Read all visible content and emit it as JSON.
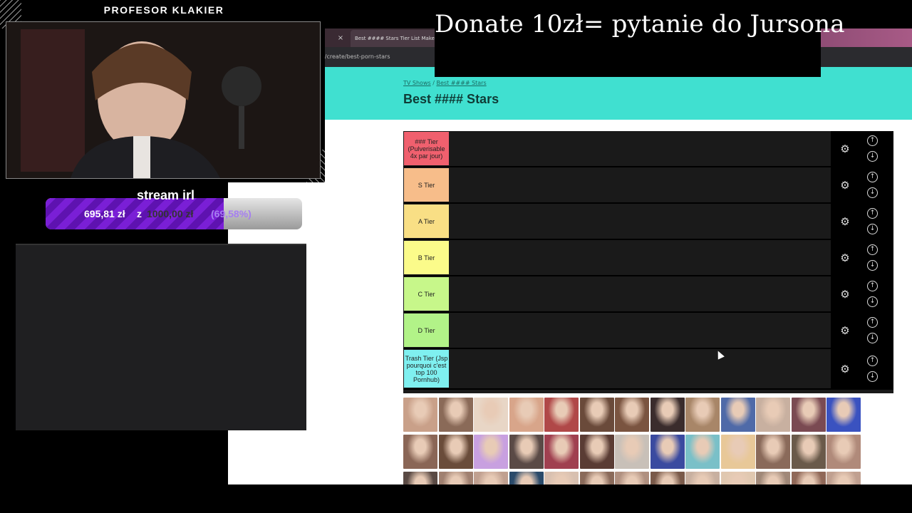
{
  "overlay": {
    "donate_text": "Donate 10zł= pytanie do Jursona",
    "streamer_name": "PROFESOR KLAKIER",
    "goal_title": "stream irl",
    "goal_amount": "695,81 zł",
    "goal_separator": "z",
    "goal_target": "1000,00 zł",
    "goal_percent": "(69,58%)",
    "goal_progress": 0.6958
  },
  "browser": {
    "tab_close": "×",
    "tab_title": "Best #### Stars Tier List Maker",
    "url": "m/create/best-porn-stars"
  },
  "page": {
    "breadcrumb_parent": "TV Shows",
    "breadcrumb_sep": "/",
    "breadcrumb_current": "Best #### Stars",
    "title": "Best #### Stars"
  },
  "tiers": [
    {
      "label": "### Tier (Pulverisable 4x par jour)",
      "color": "#f0606e"
    },
    {
      "label": "S Tier",
      "color": "#f7bd8a"
    },
    {
      "label": "A Tier",
      "color": "#f9df85"
    },
    {
      "label": "B Tier",
      "color": "#fbfb8a"
    },
    {
      "label": "C Tier",
      "color": "#c7f78a"
    },
    {
      "label": "D Tier",
      "color": "#b2f388"
    },
    {
      "label": "Trash Tier (Jsp pourquoi c'est top 100 Pornhub)",
      "color": "#7ff0f0"
    }
  ],
  "icons": {
    "settings": "gear-icon",
    "move_up": "arrow-up-circle-icon",
    "move_down": "arrow-down-circle-icon"
  },
  "pool": {
    "thumb_colors": [
      [
        "#c9a089",
        "#8a6a58",
        "#e8d6c6",
        "#d8a58a",
        "#b04848",
        "#6a4a3a",
        "#7a5440",
        "#3a2c2c",
        "#a88668",
        "#4f6aa8",
        "#c8b0a0",
        "#7a4a52",
        "#3a52c0"
      ],
      [
        "#8a6656",
        "#6a4c3a",
        "#c8a0e0",
        "#5a4a46",
        "#a04050",
        "#5a3c34",
        "#c8c0b8",
        "#3a4aa0",
        "#7ac0c8",
        "#e8c898",
        "#8a6a5a",
        "#6a5a4a",
        "#b08a7a"
      ],
      [
        "#5a4a44",
        "#a08070",
        "#c0a090",
        "#2a4a6a",
        "#d8c0b0",
        "#8a6a5a",
        "#b09080",
        "#7a5a4a",
        "#c8b0a0",
        "#e0c8b0",
        "#a08878",
        "#906858",
        "#c0a090"
      ]
    ]
  }
}
